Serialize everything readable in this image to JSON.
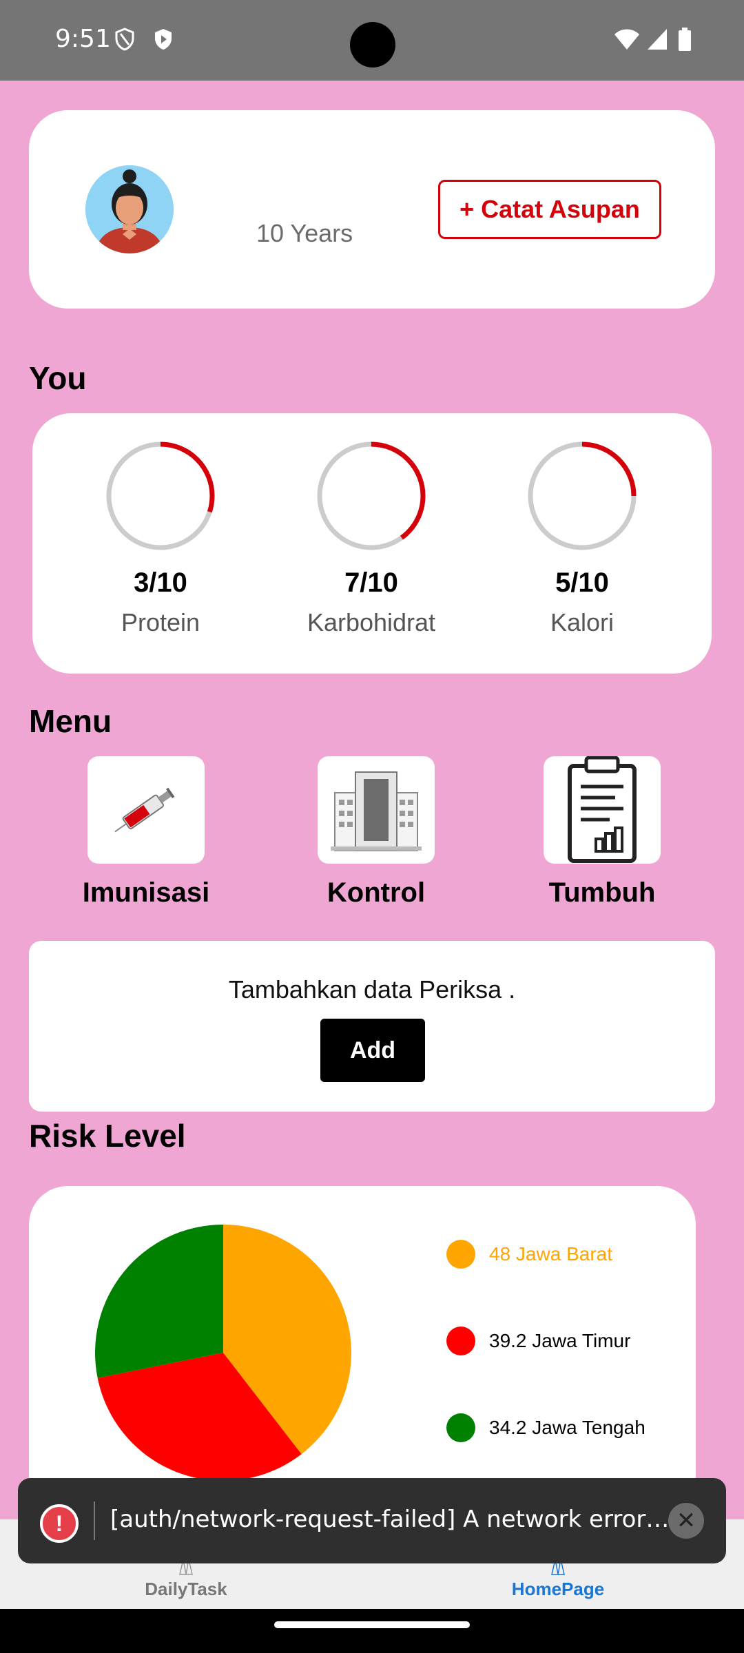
{
  "status_bar": {
    "time": "9:51"
  },
  "profile": {
    "age": "10 Years",
    "catat_button": "+ Catat Asupan"
  },
  "sections": {
    "you": "You",
    "menu": "Menu",
    "risk": "Risk Level"
  },
  "nutrition": [
    {
      "value": "3/10",
      "label": "Protein",
      "progress": 0.3
    },
    {
      "value": "7/10",
      "label": "Karbohidrat",
      "progress": 0.4
    },
    {
      "value": "5/10",
      "label": "Kalori",
      "progress": 0.25
    }
  ],
  "menu": [
    {
      "label": "Imunisasi",
      "icon": "syringe-icon"
    },
    {
      "label": "Kontrol",
      "icon": "hospital-building-icon"
    },
    {
      "label": "Tumbuh",
      "icon": "clipboard-chart-icon"
    }
  ],
  "periksa": {
    "text": "Tambahkan data Periksa .",
    "button": "Add"
  },
  "chart_data": {
    "type": "pie",
    "title": "Risk Level",
    "slices": [
      {
        "label": "Jawa Barat",
        "value": 48,
        "color": "#ffa500"
      },
      {
        "label": "Jawa Timur",
        "value": 39.2,
        "color": "#ff0000"
      },
      {
        "label": "Jawa Tengah",
        "value": 34.2,
        "color": "#008000"
      }
    ],
    "legend": [
      "48 Jawa Barat",
      "39.2 Jawa Timur",
      "34.2 Jawa Tengah"
    ],
    "legend_position": "right"
  },
  "snackbar": {
    "text": "[auth/network-request-failed] A network error (such as timeout, interrupted connection or unreachable host) has occurred."
  },
  "bottom_nav": [
    {
      "label": "DailyTask",
      "active": false
    },
    {
      "label": "HomePage",
      "active": true
    }
  ],
  "colors": {
    "background": "#f0a6d2",
    "accent": "#d4000a",
    "active_nav": "#1976d2"
  }
}
